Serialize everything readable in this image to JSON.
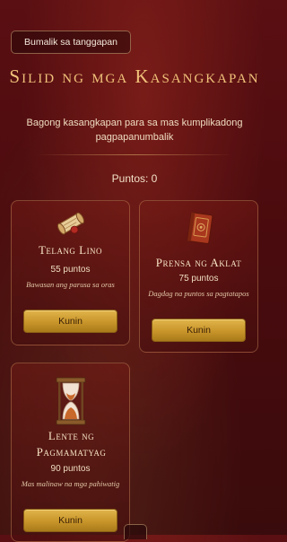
{
  "header": {
    "back_label": "Bumalik sa tanggapan",
    "title": "Silid ng mga Kasangkapan",
    "subtitle": "Bagong kasangkapan para sa mas kumplikadong pagpapanumbalik",
    "points_label": "Puntos: 0"
  },
  "tools": [
    {
      "name": "Telang Lino",
      "price": "55 puntos",
      "description": "Bawasan ang parusa sa oras",
      "button_label": "Kunin",
      "icon": "scroll-icon"
    },
    {
      "name": "Prensa ng Aklat",
      "price": "75 puntos",
      "description": "Dagdag na puntos sa pagtatapos",
      "button_label": "Kunin",
      "icon": "book-icon"
    },
    {
      "name": "Lente ng Pagmamatyag",
      "price": "90 puntos",
      "description": "Mas malinaw na mga pahiwatig",
      "button_label": "Kunin",
      "icon": "hourglass-icon"
    }
  ],
  "colors": {
    "background": "#4a0b0e",
    "title_gold": "#f0c27a",
    "button_gold": "#c8952a"
  }
}
